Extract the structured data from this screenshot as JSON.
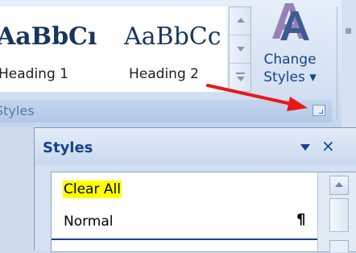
{
  "ribbon": {
    "quick_styles": [
      {
        "sample": "AaBbCı",
        "name": "Heading 1"
      },
      {
        "sample": "AaBbCc",
        "name": "Heading 2"
      }
    ],
    "change_styles": {
      "line1": "Change",
      "line2": "Styles ▾"
    },
    "group_label": "Styles"
  },
  "styles_pane": {
    "title": "Styles",
    "menu_glyph": "▼",
    "close_glyph": "×",
    "items": [
      {
        "label": "Clear All",
        "highlight": true
      },
      {
        "label": "Normal",
        "mark": "¶"
      }
    ]
  },
  "colors": {
    "accent": "#15428b",
    "highlight": "#ffff00",
    "arrow": "#e81818"
  },
  "icons": {
    "change_styles": "change-styles-icon",
    "launcher": "dialog-launcher-icon",
    "arrow": "red-arrow-annotation"
  }
}
